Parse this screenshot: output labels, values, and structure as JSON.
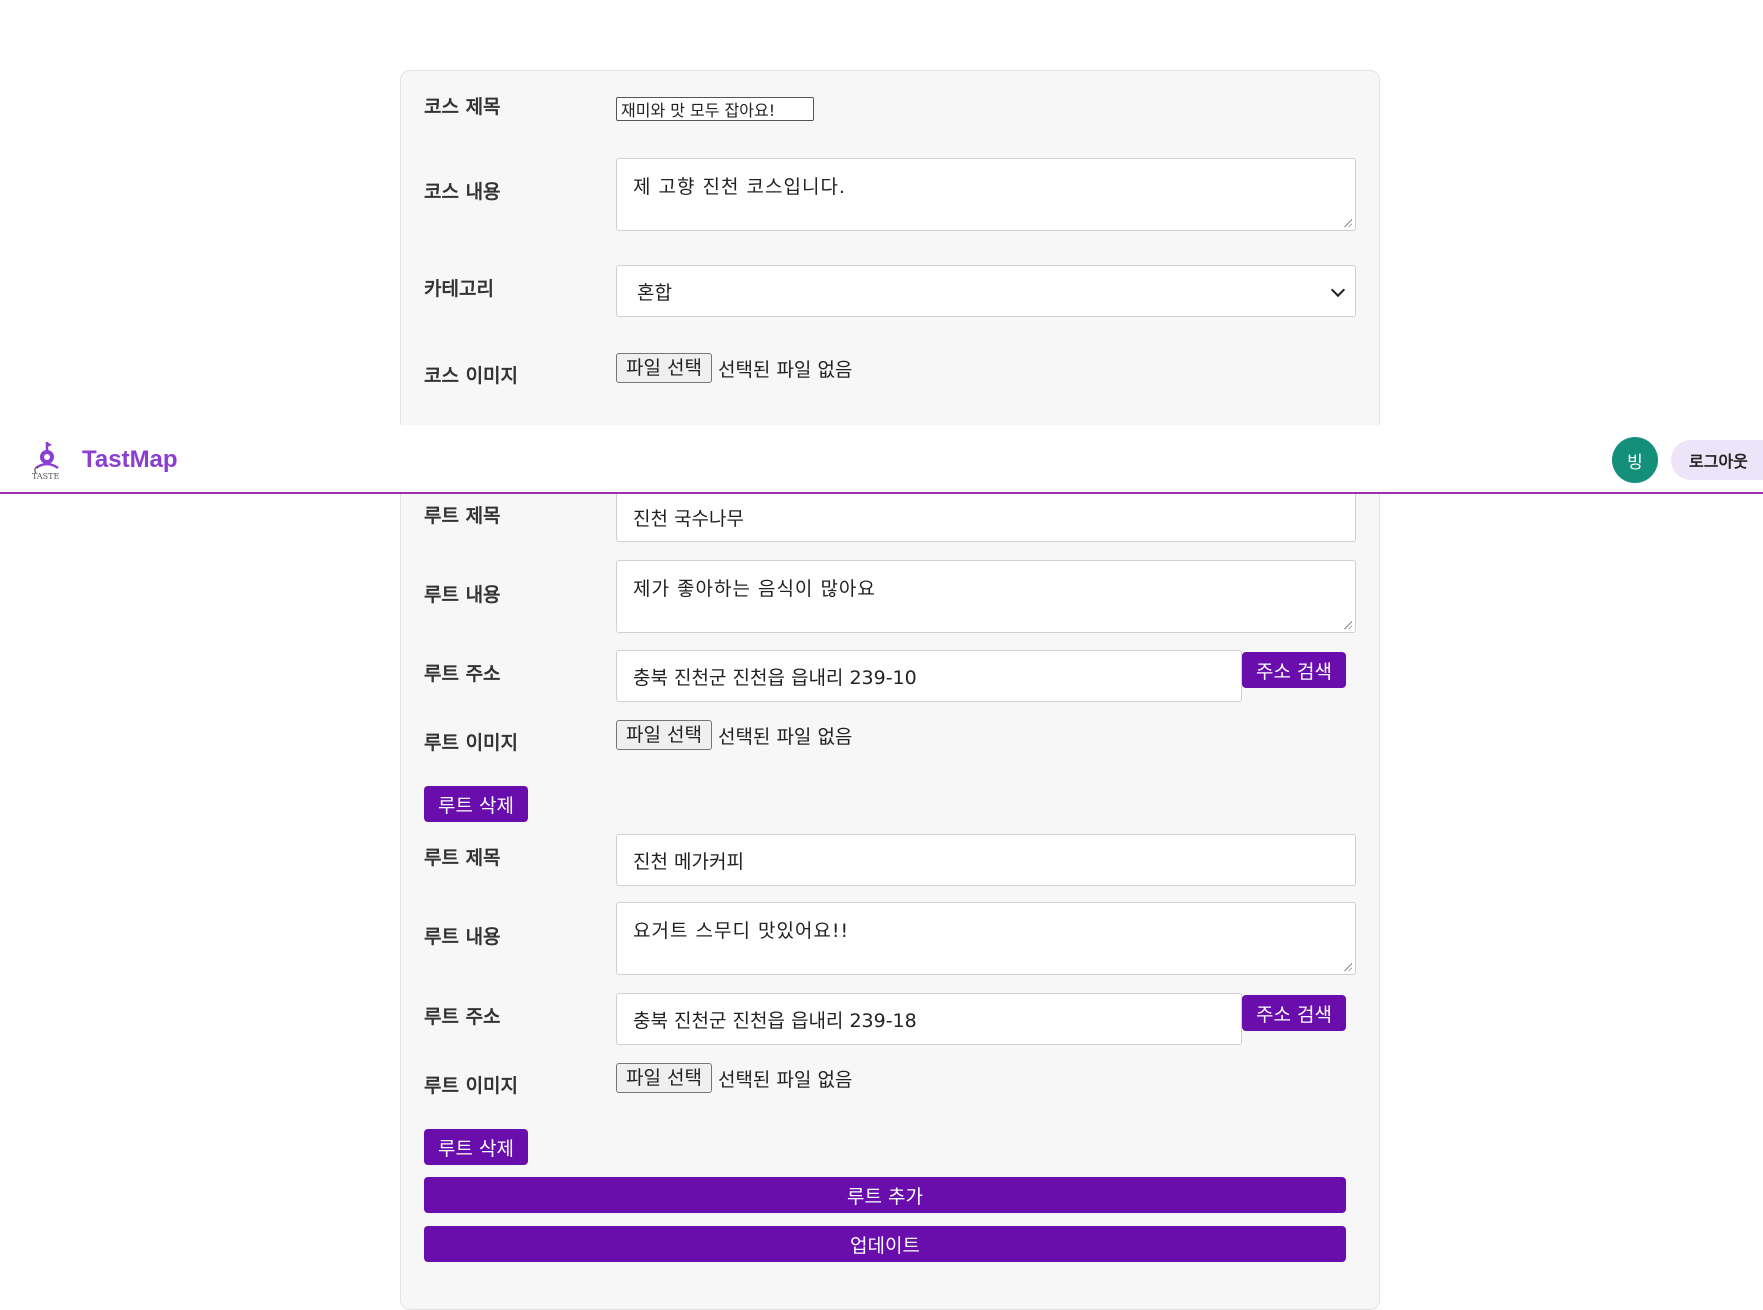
{
  "course": {
    "title_label": "코스 제목",
    "title_value": "재미와 맛 모두 잡아요!",
    "content_label": "코스 내용",
    "content_value": "제 고향 진천 코스입니다.",
    "category_label": "카테고리",
    "category_value": "혼합",
    "image_label": "코스 이미지",
    "file_button": "파일 선택",
    "file_status": "선택된 파일 없음"
  },
  "navbar": {
    "brand": "TastMap",
    "logo_text": "TASTE",
    "avatar_initial": "빙",
    "logout_label": "로그아웃",
    "accent_color": "#9b2fae"
  },
  "routes": [
    {
      "title_label": "루트 제목",
      "title_value": "진천 국수나무",
      "content_label": "루트 내용",
      "content_value": "제가 좋아하는 음식이 많아요",
      "address_label": "루트 주소",
      "address_value": "충북 진천군 진천읍 읍내리 239-10",
      "search_button": "주소 검색",
      "image_label": "루트 이미지",
      "file_button": "파일 선택",
      "file_status": "선택된 파일 없음",
      "delete_button": "루트 삭제"
    },
    {
      "title_label": "루트 제목",
      "title_value": "진천 메가커피",
      "content_label": "루트 내용",
      "content_value": "요거트 스무디 맛있어요!!",
      "address_label": "루트 주소",
      "address_value": "충북 진천군 진천읍 읍내리 239-18",
      "search_button": "주소 검색",
      "image_label": "루트 이미지",
      "file_button": "파일 선택",
      "file_status": "선택된 파일 없음",
      "delete_button": "루트 삭제"
    }
  ],
  "actions": {
    "add_route": "루트 추가",
    "update": "업데이트",
    "button_color": "#6a0dad"
  }
}
